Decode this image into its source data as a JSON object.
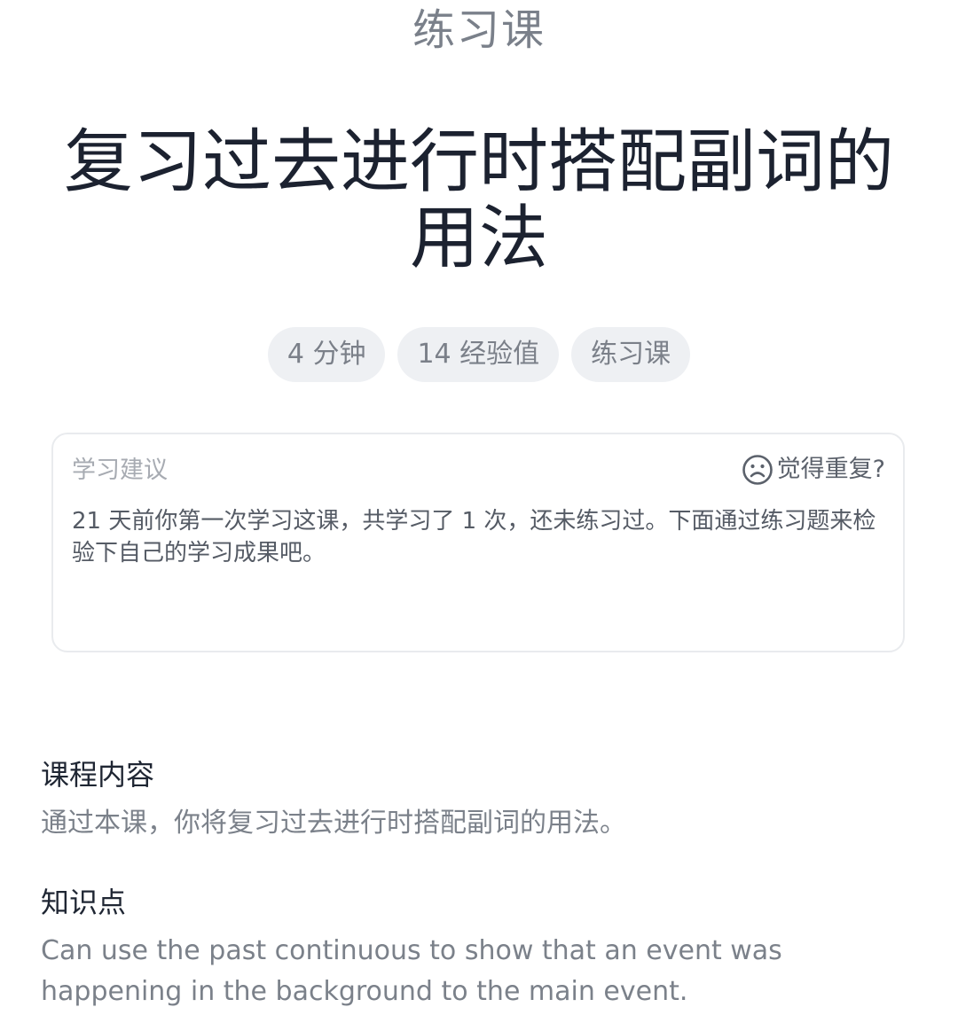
{
  "header": {
    "label": "练习课"
  },
  "lesson": {
    "title": "复习过去进行时搭配副词的用法"
  },
  "tags": [
    {
      "label": "4 分钟"
    },
    {
      "label": "14 经验值"
    },
    {
      "label": "练习课"
    }
  ],
  "advice": {
    "title": "学习建议",
    "repeat_label": "觉得重复?",
    "repeat_icon": "sad-face-icon",
    "text": "21 天前你第一次学习这课，共学习了 1 次，还未练习过。下面通过练习题来检验下自己的学习成果吧。"
  },
  "course_content": {
    "heading": "课程内容",
    "text": "通过本课，你将复习过去进行时搭配副词的用法。"
  },
  "knowledge": {
    "heading": "知识点",
    "text": "Can use the past continuous to show that an event was happening in the background to the main event."
  },
  "colors": {
    "title": "#1c2230",
    "secondary_text": "#7b818a",
    "tag_background": "#eef0f3",
    "card_border": "#e9ebee"
  }
}
